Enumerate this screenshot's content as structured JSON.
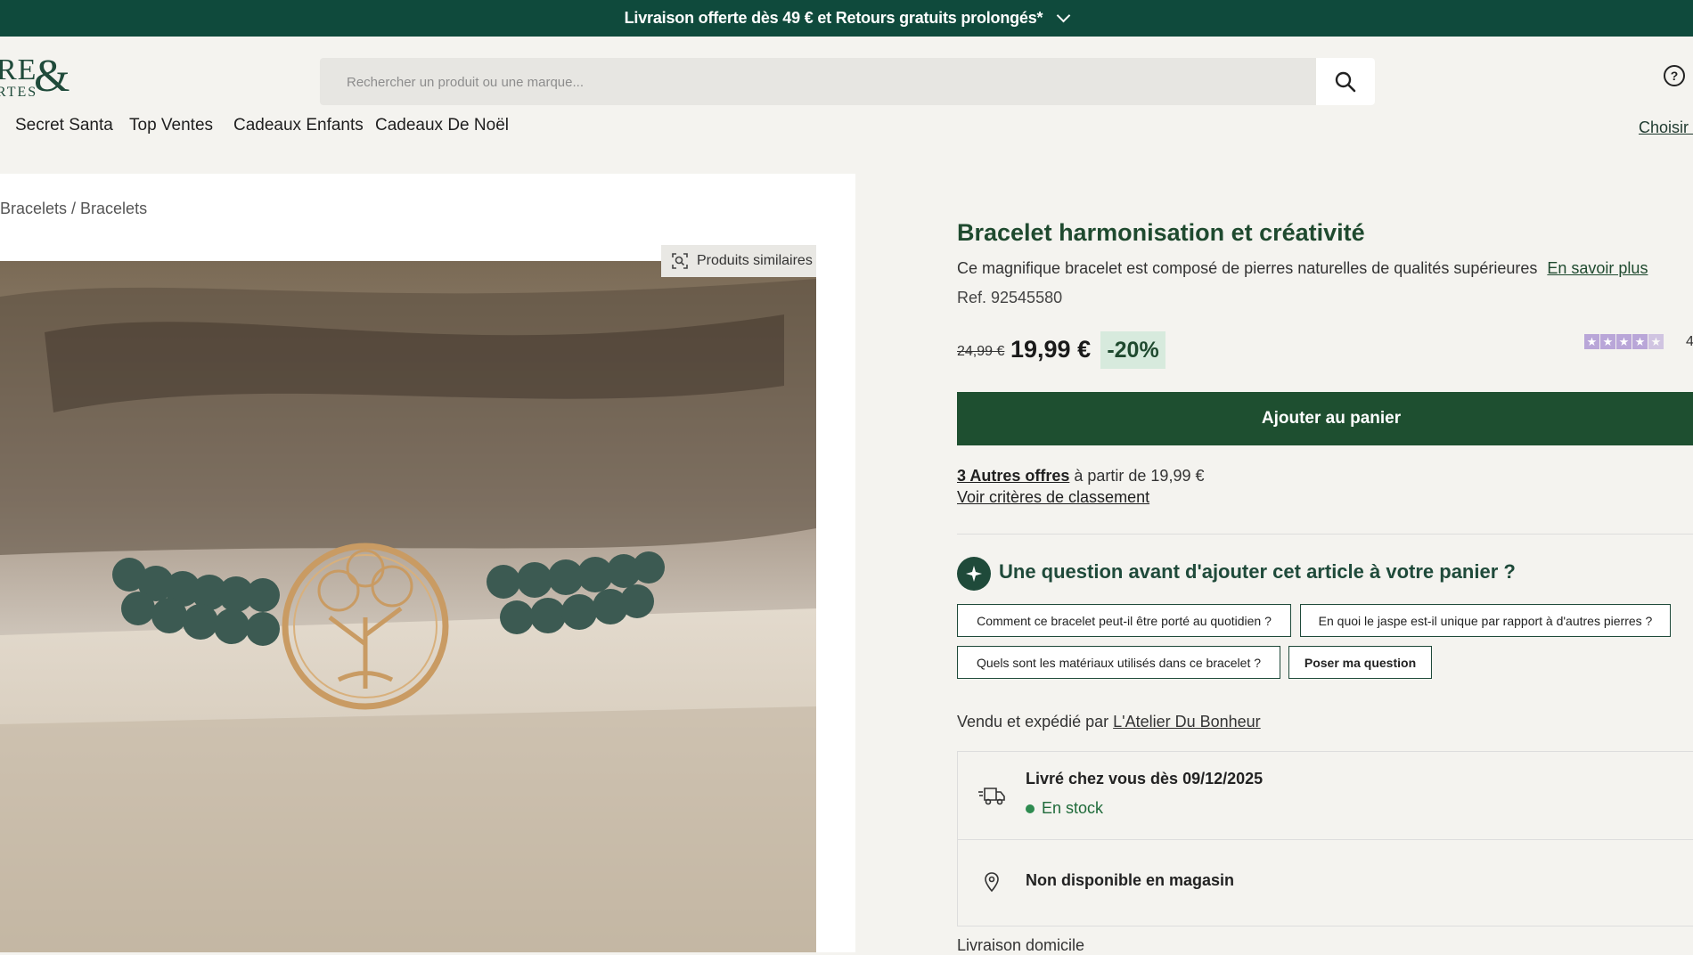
{
  "banner": {
    "text": "Livraison offerte dès 49 € et Retours gratuits prolongés*"
  },
  "logo": {
    "line1": "RE",
    "line2": "RTES",
    "amp": "&"
  },
  "search": {
    "placeholder": "Rechercher un produit ou une marque..."
  },
  "nav": {
    "items": [
      "Secret Santa",
      "Top Ventes",
      "Cadeaux Enfants",
      "Cadeaux De Noël"
    ],
    "choose_label": "Choisir m"
  },
  "breadcrumb": "Bracelets / Bracelets",
  "similar_label": "Produits similaires",
  "product": {
    "title": "Bracelet harmonisation et créativité",
    "description": "Ce magnifique bracelet est composé de pierres naturelles de qualités supérieures",
    "learn_more": "En savoir plus",
    "ref": "Ref. 92545580",
    "old_price": "24,99 €",
    "price": "19,99 €",
    "discount": "-20%",
    "rating_partial": "4",
    "add_to_cart": "Ajouter au panier",
    "offers_link": "3 Autres offres",
    "offers_text": " à partir de 19,99 €",
    "criteria_link": "Voir critères de classement"
  },
  "question": {
    "title": "Une question avant d'ajouter cet article à votre panier ?",
    "chips": [
      "Comment ce bracelet peut-il être porté au quotidien ?",
      "En quoi le jaspe est-il unique par rapport à d'autres pierres ?",
      "Quels sont les matériaux utilisés dans ce bracelet ?"
    ],
    "ask_button": "Poser ma question"
  },
  "seller": {
    "prefix": "Vendu et expédié par ",
    "name": "L'Atelier Du Bonheur"
  },
  "delivery": {
    "date_text": "Livré chez vous dès 09/12/2025",
    "stock": "En stock",
    "store": "Non disponible en magasin",
    "home": "Livraison domicile"
  },
  "colors": {
    "brand": "#0f4a3c",
    "cta": "#1e4f30",
    "discount_bg": "#d7eadd",
    "stars": "#b9a6d8"
  }
}
